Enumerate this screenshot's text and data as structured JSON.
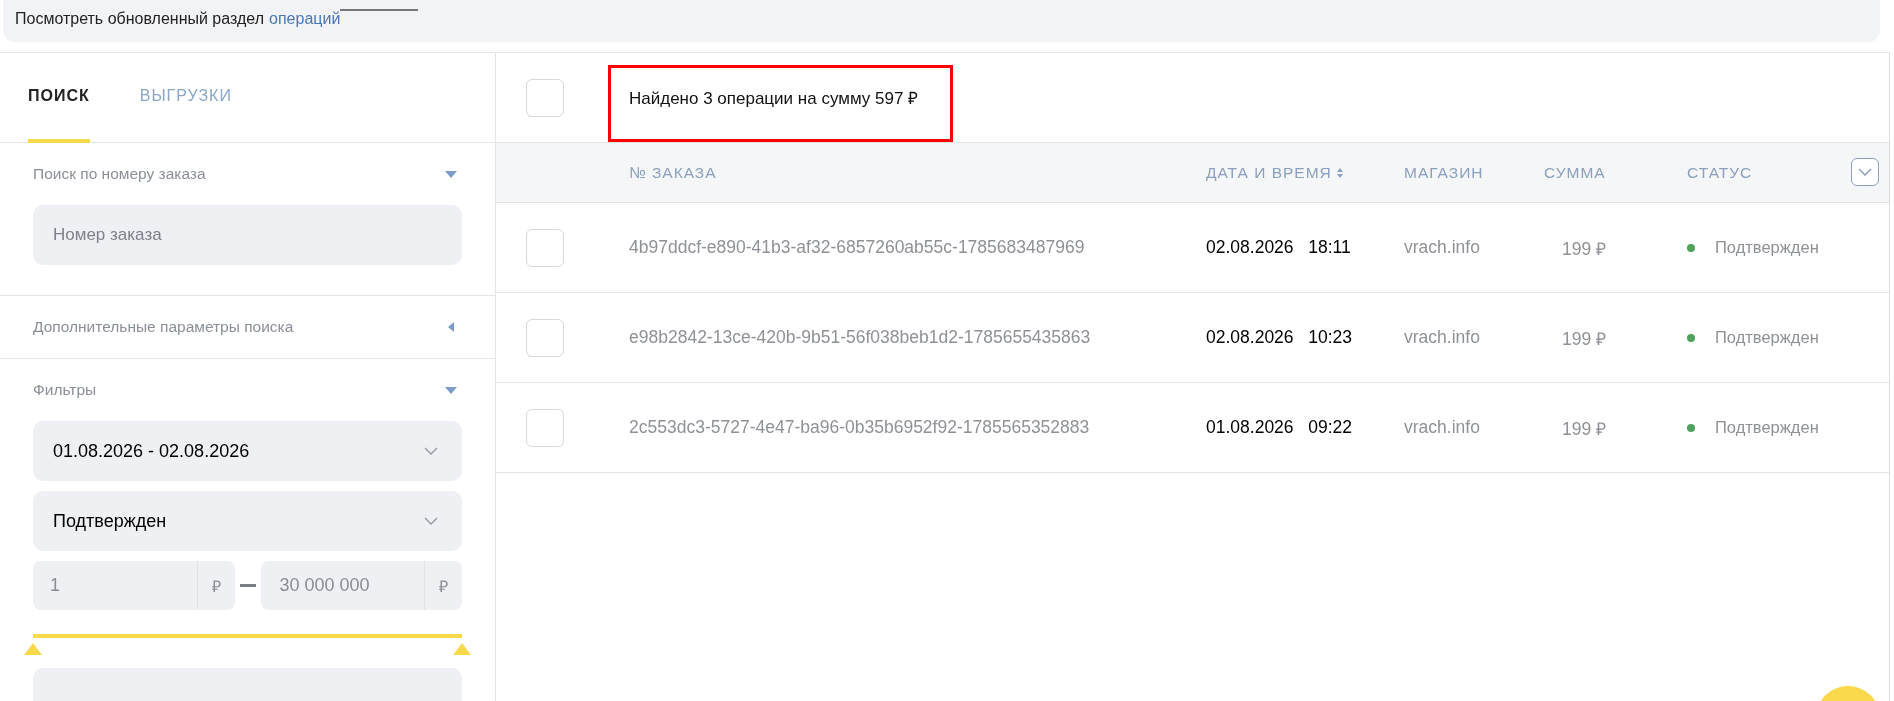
{
  "banner": {
    "text": "Посмотреть обновленный раздел",
    "link": "операций"
  },
  "sidebar": {
    "tabs": [
      {
        "label": "ПОИСК",
        "selected": true
      },
      {
        "label": "ВЫГРУЗКИ",
        "selected": false
      }
    ],
    "order_search": {
      "title": "Поиск по номеру заказа",
      "expanded": true,
      "placeholder": "Номер заказа"
    },
    "extra_params": {
      "title": "Дополнительные параметры поиска",
      "expanded": false
    },
    "filters": {
      "title": "Фильтры",
      "expanded": true,
      "date_range": "01.08.2026 - 02.08.2026",
      "status": "Подтвержден",
      "amount_from": {
        "value": "1",
        "currency": "₽"
      },
      "amount_to": {
        "value": "30 000 000",
        "currency": "₽"
      },
      "slider_thumbs": [
        {
          "level": 0
        },
        {
          "level": 1
        }
      ]
    }
  },
  "results": {
    "select_all_checked": false,
    "summary": "Найдено 3 операции на сумму 597 ₽",
    "columns": [
      "№ ЗАКАЗА",
      "ДАТА И ВРЕМЯ",
      "МАГАЗИН",
      "СУММА",
      "СТАТУС"
    ],
    "rows": [
      {
        "checked": false,
        "order": "4b97ddcf-e890-41b3-af32-6857260ab55c-1785683487969",
        "date": "02.08.2026",
        "time": "18:11",
        "shop": "vrach.info",
        "amount": "199 ₽",
        "status": "Подтвержден",
        "color": "#4ea05a"
      },
      {
        "checked": false,
        "order": "e98b2842-13ce-420b-9b51-56f038beb1d2-1785655435863",
        "date": "02.08.2026",
        "time": "10:23",
        "shop": "vrach.info",
        "amount": "199 ₽",
        "status": "Подтвержден",
        "color": "#4ea05a"
      },
      {
        "checked": false,
        "order": "2c553dc3-5727-4e47-ba96-0b35b6952f92-1785565352883",
        "date": "01.08.2026",
        "time": "09:22",
        "shop": "vrach.info",
        "amount": "199 ₽",
        "status": "Подтвержден",
        "color": "#4ea05a"
      }
    ]
  }
}
